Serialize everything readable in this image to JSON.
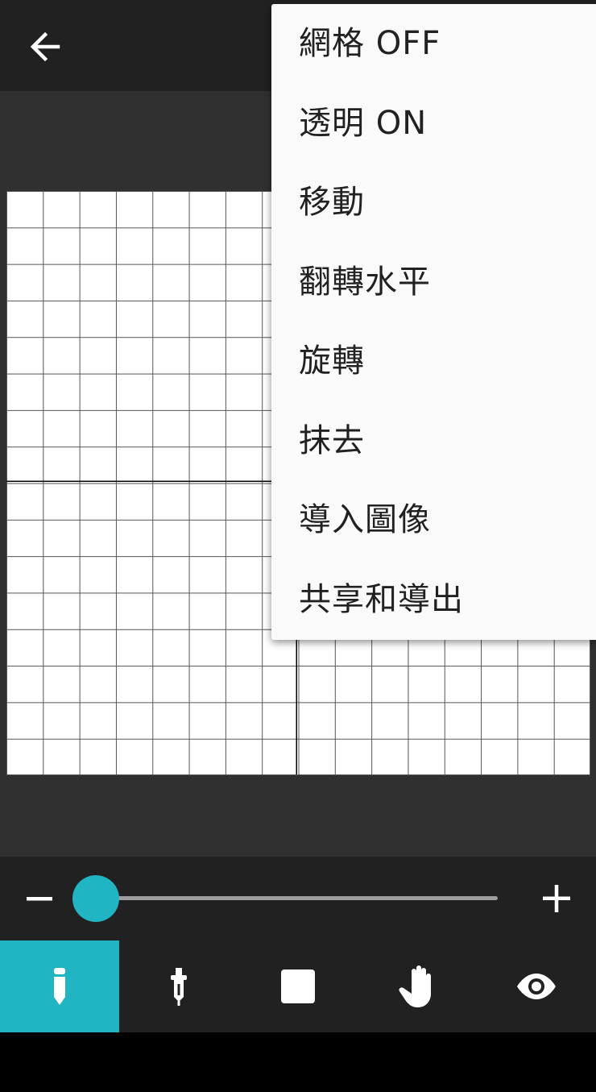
{
  "app": {
    "back_icon": "arrow-left-icon"
  },
  "menu": {
    "items": [
      {
        "label": "網格 OFF"
      },
      {
        "label": "透明 ON"
      },
      {
        "label": "移動"
      },
      {
        "label": "翻轉水平"
      },
      {
        "label": "旋轉"
      },
      {
        "label": "抹去"
      },
      {
        "label": "導入圖像"
      },
      {
        "label": "共享和導出"
      }
    ]
  },
  "grid": {
    "columns": 16,
    "rows": 16,
    "background": "#ffffff"
  },
  "slider": {
    "value": 0,
    "minus_icon": "minus-icon",
    "plus_icon": "plus-icon",
    "accent_color": "#21b5c3"
  },
  "toolbar": {
    "active_tool": "pencil",
    "tools": [
      {
        "name": "pencil",
        "icon": "pencil-icon"
      },
      {
        "name": "eyedropper",
        "icon": "eyedropper-icon"
      },
      {
        "name": "color",
        "icon": "color-square-icon"
      },
      {
        "name": "pan",
        "icon": "hand-icon"
      },
      {
        "name": "preview",
        "icon": "eye-icon"
      }
    ]
  },
  "colors": {
    "appbar": "#212121",
    "canvas_bg": "#303030",
    "accent": "#21b5c3",
    "menu_bg": "#fafafa"
  }
}
